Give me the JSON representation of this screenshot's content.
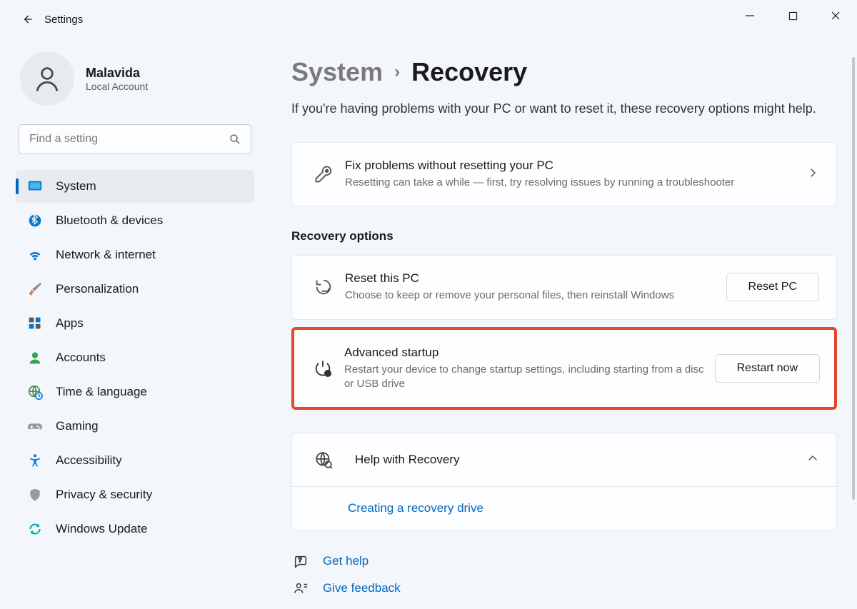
{
  "app": {
    "title": "Settings"
  },
  "user": {
    "name": "Malavida",
    "subtitle": "Local Account"
  },
  "search": {
    "placeholder": "Find a setting"
  },
  "sidebar": {
    "items": [
      {
        "label": "System",
        "icon": "system-icon",
        "active": true
      },
      {
        "label": "Bluetooth & devices",
        "icon": "bluetooth-icon"
      },
      {
        "label": "Network & internet",
        "icon": "wifi-icon"
      },
      {
        "label": "Personalization",
        "icon": "brush-icon"
      },
      {
        "label": "Apps",
        "icon": "apps-icon"
      },
      {
        "label": "Accounts",
        "icon": "person-icon"
      },
      {
        "label": "Time & language",
        "icon": "globe-clock-icon"
      },
      {
        "label": "Gaming",
        "icon": "gamepad-icon"
      },
      {
        "label": "Accessibility",
        "icon": "accessibility-icon"
      },
      {
        "label": "Privacy & security",
        "icon": "shield-icon"
      },
      {
        "label": "Windows Update",
        "icon": "update-icon"
      }
    ]
  },
  "breadcrumb": {
    "parent": "System",
    "current": "Recovery"
  },
  "subtitle": "If you're having problems with your PC or want to reset it, these recovery options might help.",
  "fixCard": {
    "title": "Fix problems without resetting your PC",
    "desc": "Resetting can take a while — first, try resolving issues by running a troubleshooter"
  },
  "recoveryHeading": "Recovery options",
  "resetCard": {
    "title": "Reset this PC",
    "desc": "Choose to keep or remove your personal files, then reinstall Windows",
    "button": "Reset PC"
  },
  "advancedCard": {
    "title": "Advanced startup",
    "desc": "Restart your device to change startup settings, including starting from a disc or USB drive",
    "button": "Restart now"
  },
  "help": {
    "title": "Help with Recovery",
    "link": "Creating a recovery drive"
  },
  "footer": {
    "getHelp": "Get help",
    "feedback": "Give feedback"
  }
}
